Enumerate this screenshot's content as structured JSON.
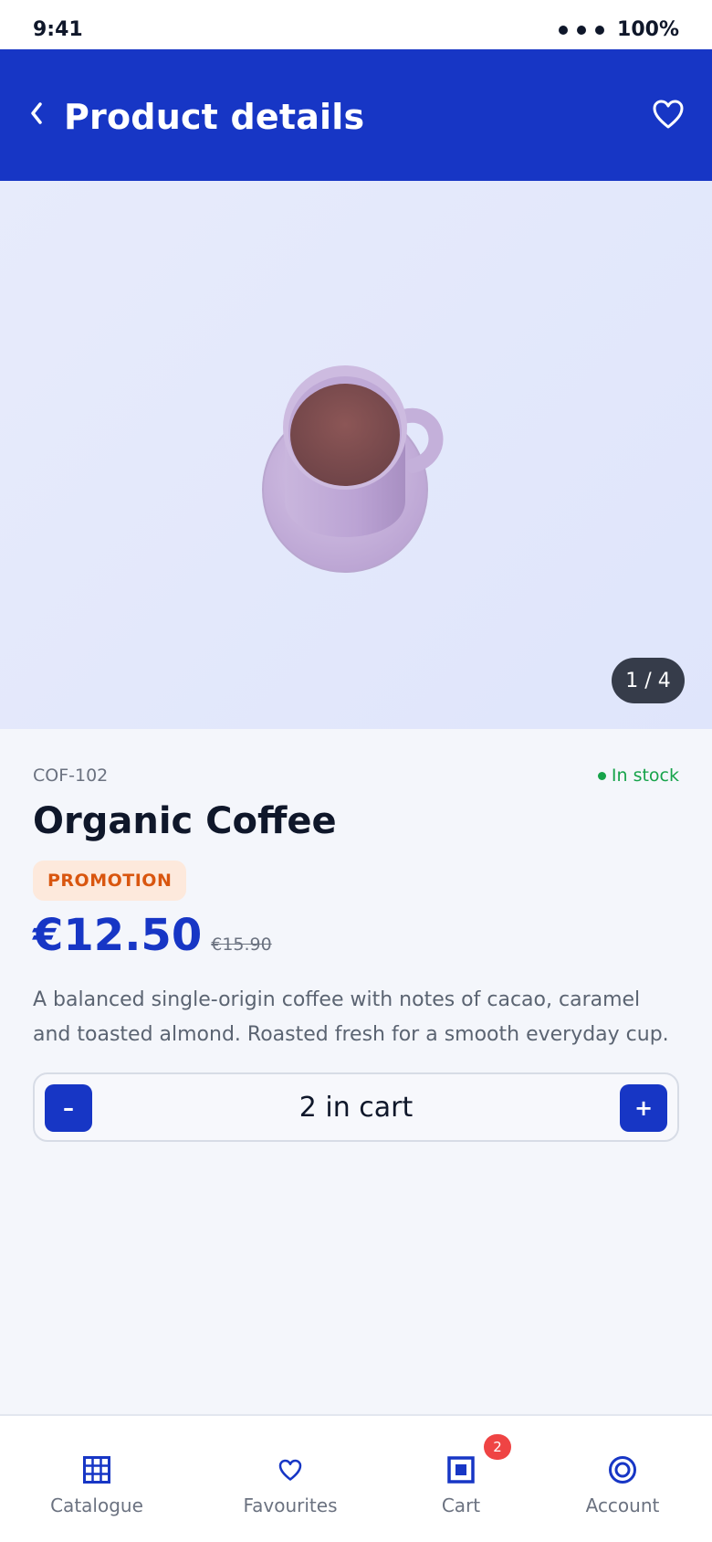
{
  "status_bar": {
    "time": "9:41",
    "battery": "100%"
  },
  "header": {
    "title": "Product details"
  },
  "gallery": {
    "counter": "1 / 4",
    "image_icon": "coffee-cup-icon"
  },
  "product": {
    "sku": "COF-102",
    "stock": "In stock",
    "name": "Organic Coffee",
    "badge": "PROMOTION",
    "price": "€12.50",
    "old_price": "€15.90",
    "description": "A balanced single-origin coffee with notes of cacao, caramel and toasted almond. Roasted fresh for a smooth everyday cup."
  },
  "cart_stepper": {
    "minus_label": "–",
    "plus_label": "+",
    "label": "2 in cart"
  },
  "bottom_nav": {
    "items": [
      {
        "label": "Catalogue",
        "icon": "grid-icon"
      },
      {
        "label": "Favourites",
        "icon": "heart-icon"
      },
      {
        "label": "Cart",
        "icon": "cart-icon",
        "badge": "2"
      },
      {
        "label": "Account",
        "icon": "account-icon"
      }
    ]
  },
  "colors": {
    "primary": "#1736c5",
    "stock_green": "#16a34a",
    "promo_bg": "#fde9dc",
    "promo_text": "#d9560f",
    "badge_red": "#ef4444"
  }
}
